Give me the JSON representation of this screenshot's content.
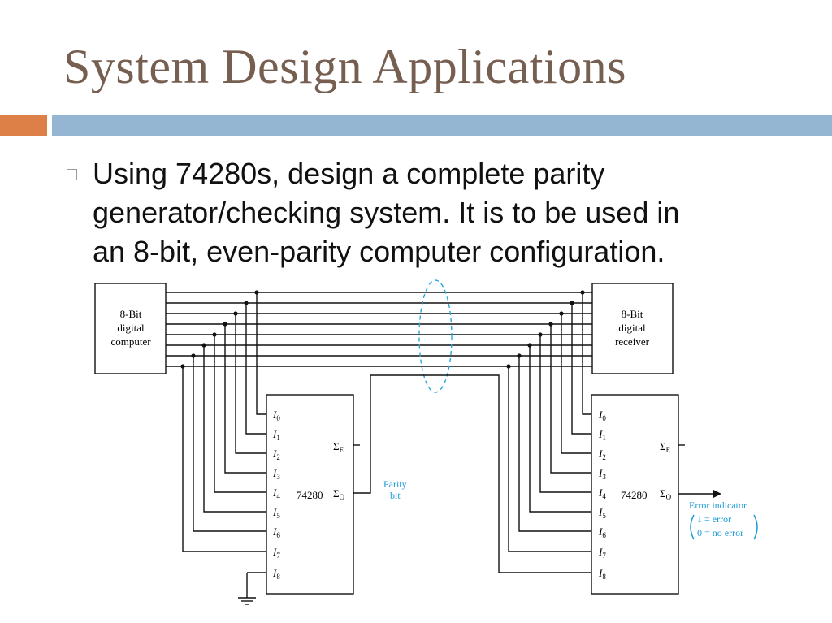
{
  "slide": {
    "title": "System Design Applications",
    "bullet_lines": [
      "Using 74280s, design a complete parity",
      "generator/checking system. It is to be used in",
      "an 8-bit, even-parity computer configuration."
    ]
  },
  "diagram": {
    "computer_lines": [
      "8-Bit",
      "digital",
      "computer"
    ],
    "receiver_lines": [
      "8-Bit",
      "digital",
      "receiver"
    ],
    "chip_label": "74280",
    "input_labels": [
      "I0",
      "I1",
      "I2",
      "I3",
      "I4",
      "I5",
      "I6",
      "I7",
      "I8"
    ],
    "output_even": "ΣE",
    "output_odd": "ΣO",
    "parity_lines": [
      "Parity",
      "bit"
    ],
    "error_indicator": {
      "title": "Error indicator",
      "line1": "1 = error",
      "line2": "0 = no error"
    },
    "colors": {
      "wire": "#111111",
      "annotation": "#1a9ad6",
      "cable_outline": "#2aa6dc"
    }
  }
}
